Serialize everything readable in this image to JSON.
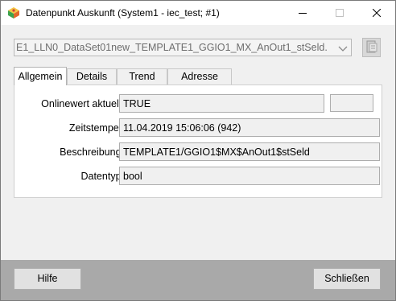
{
  "window": {
    "title": "Datenpunkt Auskunft (System1 - iec_test; #1)",
    "icon": "datapoint-app-icon",
    "controls": {
      "minimize": "minimize-icon",
      "maximize": "maximize-icon",
      "close": "close-icon"
    }
  },
  "datapoint_select": {
    "value": "E1_LLN0_DataSet01new_TEMPLATE1_GGIO1_MX_AnOut1_stSeld.",
    "arrow_icon": "chevron-down-icon",
    "side_button_icon": "datapoint-browse-icon"
  },
  "tabs": [
    {
      "label": "Allgemein",
      "active": true
    },
    {
      "label": "Details",
      "active": false
    },
    {
      "label": "Trend",
      "active": false
    },
    {
      "label": "Adresse",
      "active": false
    }
  ],
  "general": {
    "online_value_label": "Onlinewert aktuell:",
    "online_value": "TRUE",
    "online_extra_1": "",
    "online_extra_2": "",
    "timestamp_label": "Zeitstempel:",
    "timestamp_value": "11.04.2019 15:06:06  (942)",
    "description_label": "Beschreibung:",
    "description_value": "TEMPLATE1/GGIO1$MX$AnOut1$stSeld",
    "datatype_label": "Datentyp:",
    "datatype_value": "bool"
  },
  "footer": {
    "help_label": "Hilfe",
    "close_label": "Schließen"
  },
  "colors": {
    "window_background": "#f0f0f0",
    "footer_background": "#a9a9a9",
    "field_background": "#f0f0f0",
    "panel_background": "#ffffff"
  }
}
